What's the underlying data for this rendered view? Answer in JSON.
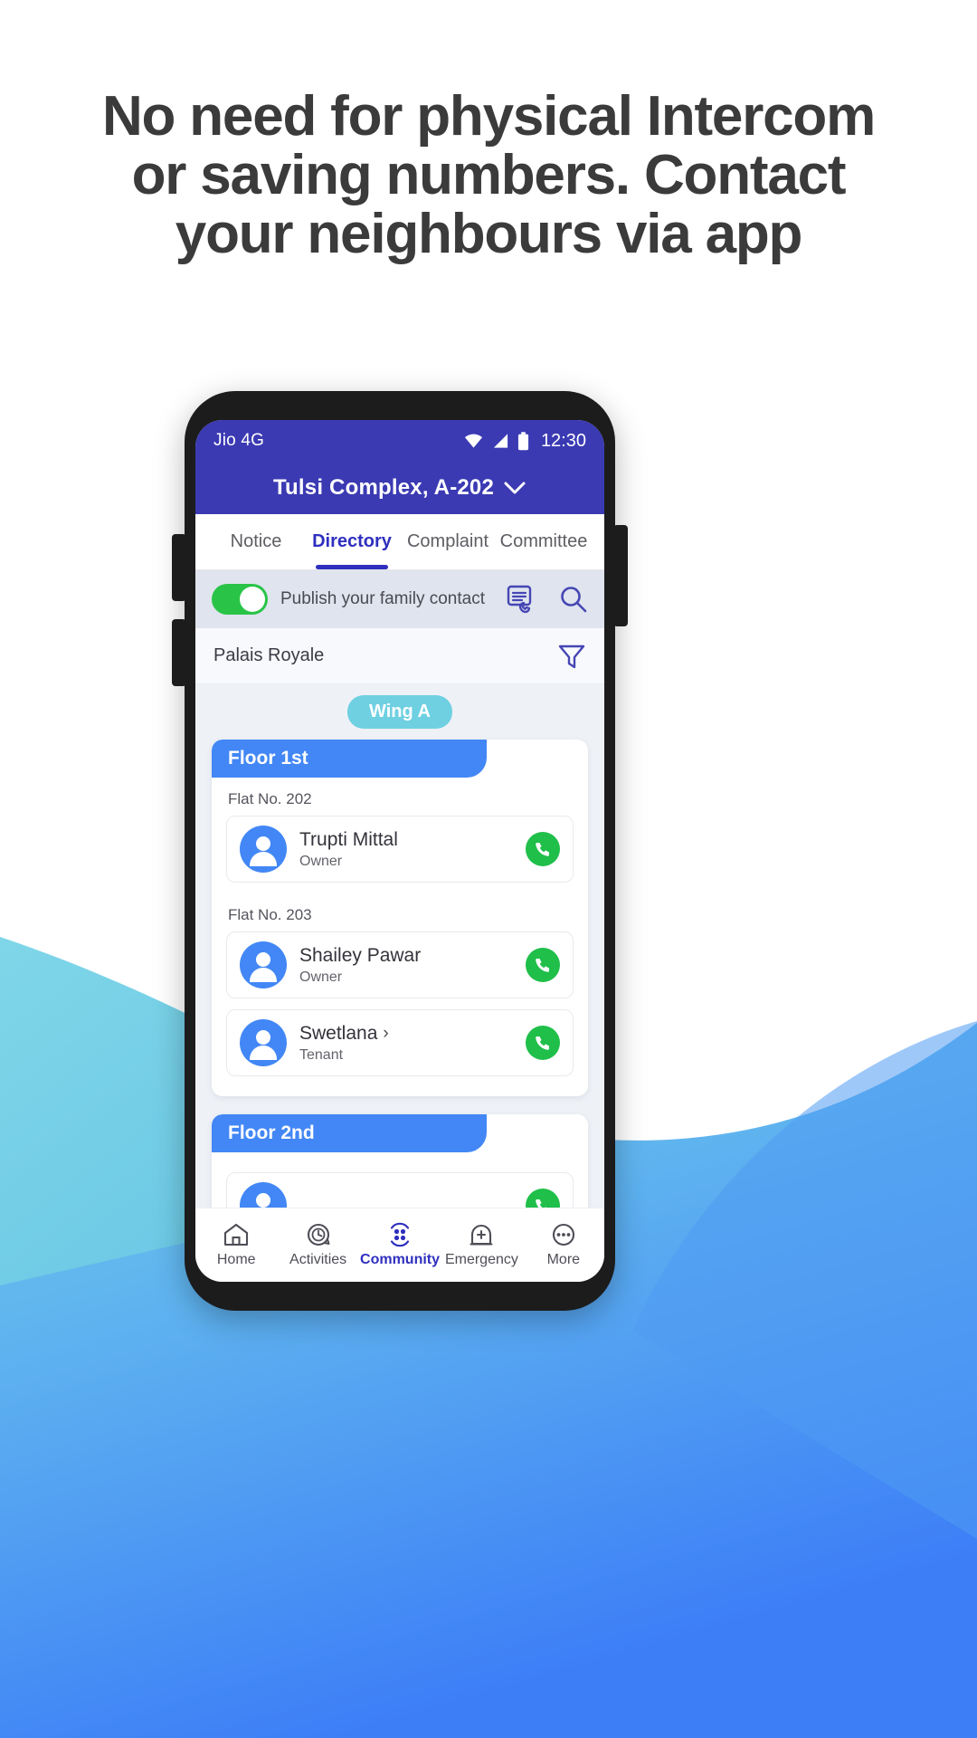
{
  "headline": "No need for physical Intercom or saving numbers. Contact your neighbours via app",
  "colors": {
    "appbar": "#3b3ab3",
    "accent_blue": "#2f2fbf",
    "floor_blue": "#4287f5",
    "wing_teal": "#6fd0e2",
    "toggle_green": "#29c447",
    "call_green": "#1fbf4a",
    "headline_text": "#3b3b3b",
    "bg_light_blue": "#6fd0e2",
    "bg_blue": "#4287f5"
  },
  "statusbar": {
    "carrier": "Jio 4G",
    "time": "12:30",
    "icons": [
      "wifi-icon",
      "signal-icon",
      "battery-icon"
    ]
  },
  "appbar": {
    "title": "Tulsi Complex, A-202",
    "dropdown_icon": "chevron-down-icon"
  },
  "tabs": [
    {
      "label": "Notice",
      "active": false
    },
    {
      "label": "Directory",
      "active": true
    },
    {
      "label": "Complaint",
      "active": false
    },
    {
      "label": "Committee",
      "active": false
    }
  ],
  "publish_row": {
    "toggle_label": "Publish your family contact",
    "toggle_on": true,
    "icons": [
      "contact-list-phone-icon",
      "search-icon"
    ]
  },
  "society_row": {
    "name": "Palais Royale",
    "filter_icon": "filter-icon"
  },
  "directory": {
    "wing": "Wing A",
    "floors": [
      {
        "title": "Floor 1st",
        "flats": [
          {
            "flat_label": "Flat No. 202",
            "residents": [
              {
                "name": "Trupti Mittal",
                "role": "Owner",
                "has_chevron": false,
                "call": true
              }
            ]
          },
          {
            "flat_label": "Flat No. 203",
            "residents": [
              {
                "name": "Shailey Pawar",
                "role": "Owner",
                "has_chevron": false,
                "call": true
              },
              {
                "name": "Swetlana",
                "role": "Tenant",
                "has_chevron": true,
                "call": true
              }
            ]
          }
        ]
      },
      {
        "title": "Floor 2nd",
        "flats": []
      }
    ]
  },
  "bottom_nav": [
    {
      "label": "Home",
      "icon": "home-icon",
      "active": false
    },
    {
      "label": "Activities",
      "icon": "clock-refresh-icon",
      "active": false
    },
    {
      "label": "Community",
      "icon": "community-dots-icon",
      "active": true
    },
    {
      "label": "Emergency",
      "icon": "emergency-plus-icon",
      "active": false
    },
    {
      "label": "More",
      "icon": "more-dots-icon",
      "active": false
    }
  ]
}
